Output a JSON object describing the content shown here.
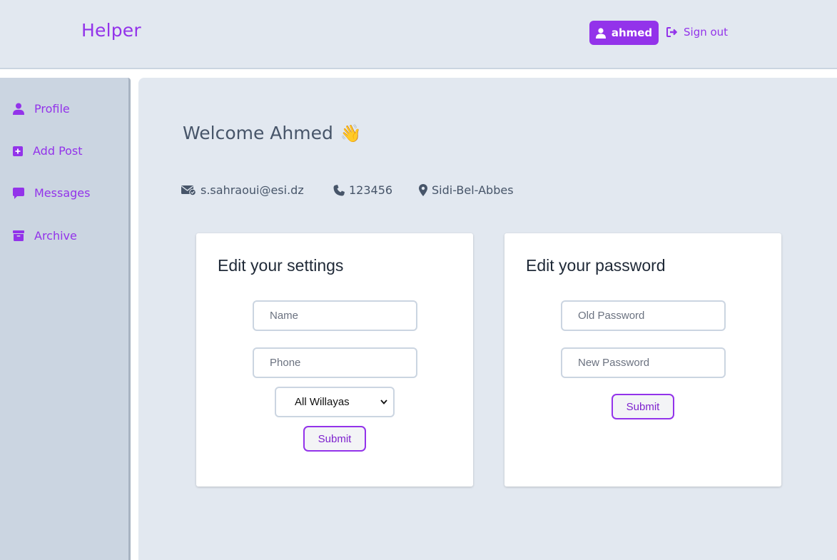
{
  "header": {
    "brand": "Helper",
    "user_label": "ahmed",
    "signout_label": "Sign out",
    "user_icon": "user-icon",
    "signout_icon": "sign-out-icon"
  },
  "sidebar": {
    "items": [
      {
        "label": "Profile",
        "icon": "user-icon"
      },
      {
        "label": "Add Post",
        "icon": "plus-square-icon"
      },
      {
        "label": "Messages",
        "icon": "message-icon"
      },
      {
        "label": "Archive",
        "icon": "archive-icon"
      }
    ]
  },
  "profile": {
    "welcome": "Welcome Ahmed",
    "wave_emoji": "👋",
    "email": "s.sahraoui@esi.dz",
    "phone": "123456",
    "location": "Sidi-Bel-Abbes"
  },
  "settings_card": {
    "title": "Edit your settings",
    "name_placeholder": "Name",
    "phone_placeholder": "Phone",
    "willaya_selected": "All Willayas",
    "submit_label": "Submit"
  },
  "password_card": {
    "title": "Edit your password",
    "old_placeholder": "Old Password",
    "new_placeholder": "New Password",
    "submit_label": "Submit"
  },
  "colors": {
    "accent": "#9333ea",
    "background": "#e2e8f0",
    "sidebar": "#cbd5e1",
    "text": "#475569"
  }
}
